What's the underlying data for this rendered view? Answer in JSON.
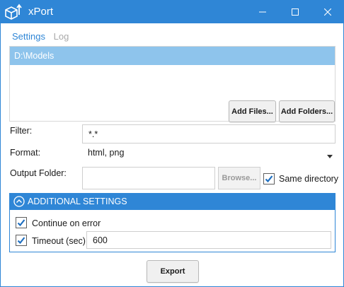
{
  "window": {
    "title": "xPort",
    "accent_color": "#2f86d6",
    "icons": [
      "app-logo-icon",
      "minimize-icon",
      "maximize-icon",
      "close-icon"
    ]
  },
  "menu": {
    "settings_label": "Settings",
    "log_label": "Log"
  },
  "file_list": {
    "items": [
      "D:\\Models"
    ],
    "selected_color": "#8ec4ec"
  },
  "buttons": {
    "add_files": "Add Files...",
    "add_folders": "Add Folders...",
    "browse": "Browse...",
    "export": "Export"
  },
  "filter": {
    "label": "Filter:",
    "value": "*.*"
  },
  "format": {
    "label": "Format:",
    "selected": "html, png"
  },
  "output_folder": {
    "label": "Output Folder:",
    "value": "",
    "same_directory_label": "Same directory",
    "same_directory_checked": true
  },
  "additional_settings": {
    "title": "ADDITIONAL SETTINGS",
    "expanded": true,
    "continue_on_error_label": "Continue on error",
    "continue_on_error_checked": true,
    "timeout_label": "Timeout (sec):",
    "timeout_checked": true,
    "timeout_value": "600"
  }
}
